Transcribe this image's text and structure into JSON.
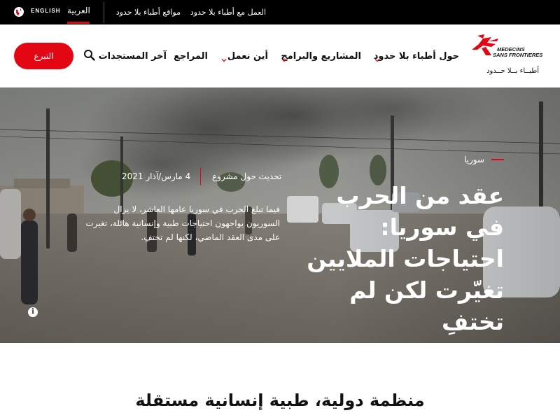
{
  "topbar": {
    "language_english": "ENGLISH",
    "language_arabic": "العربية",
    "links": [
      "مواقع أطباء بلا حدود",
      "العمل مع أطباء بلا حدود"
    ]
  },
  "header": {
    "logo_text_line1": "MEDECINS",
    "logo_text_line2": "SANS FRONTIERES",
    "logo_tagline": "أطبــاء بــلا حــدود",
    "donate_label": "التبرع",
    "nav": [
      {
        "label": "حول أطباء بلا حدود",
        "has_caret": true
      },
      {
        "label": "المشاريع والبرامج",
        "has_caret": true
      },
      {
        "label": "أين نعمل",
        "has_caret": true
      },
      {
        "label": "المراجع",
        "has_caret": false
      },
      {
        "label": "آخر المستجدات",
        "has_caret": false
      }
    ]
  },
  "hero": {
    "category": "سوريا",
    "title": "عقد من الحرب في سوريا: احتياجات الملايين تغيّرت لكن لم تختفِ",
    "type": "تحديث حول مشروع",
    "date": "4 مارس/آذار 2021",
    "description": "فيما تبلغ الحرب في سوريا عامها العاشر، لا يزال السوريون يواجهون احتياجات طبية وإنسانية هائلة، تغيرت على مدى العقد الماضي، لكنها لم تختفِ."
  },
  "section": {
    "title": "منظمة دولية، طبية إنسانية مستقلة"
  },
  "colors": {
    "brand_red": "#e30613",
    "topbar_bg": "#000000"
  },
  "icons": [
    "globe-icon",
    "search-icon",
    "chevron-down-icon",
    "info-icon",
    "msf-logo"
  ]
}
